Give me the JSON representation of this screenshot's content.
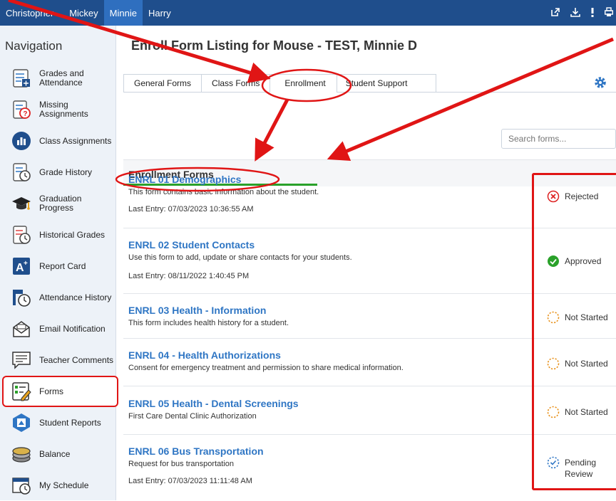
{
  "topbar": {
    "tabs": [
      {
        "label": "Christopher"
      },
      {
        "label": "Mickey"
      },
      {
        "label": "Minnie"
      },
      {
        "label": "Harry"
      }
    ],
    "active_tab": "Minnie"
  },
  "sidebar": {
    "title": "Navigation",
    "items": [
      {
        "label": "Grades and Attendance",
        "icon": "grades-attendance-icon"
      },
      {
        "label": "Missing Assignments",
        "icon": "missing-assignments-icon"
      },
      {
        "label": "Class Assignments",
        "icon": "class-assignments-icon"
      },
      {
        "label": "Grade History",
        "icon": "grade-history-icon"
      },
      {
        "label": "Graduation Progress",
        "icon": "graduation-cap-icon"
      },
      {
        "label": "Historical Grades",
        "icon": "historical-grades-icon"
      },
      {
        "label": "Report Card",
        "icon": "report-card-icon"
      },
      {
        "label": "Attendance History",
        "icon": "attendance-history-icon"
      },
      {
        "label": "Email Notification",
        "icon": "email-icon"
      },
      {
        "label": "Teacher Comments",
        "icon": "comments-icon"
      },
      {
        "label": "Forms",
        "icon": "forms-icon"
      },
      {
        "label": "Student Reports",
        "icon": "student-reports-icon"
      },
      {
        "label": "Balance",
        "icon": "balance-icon"
      },
      {
        "label": "My Schedule",
        "icon": "schedule-icon"
      }
    ]
  },
  "main": {
    "title": "Enroll Form Listing for Mouse - TEST, Minnie D",
    "tabs": [
      {
        "label": "General Forms"
      },
      {
        "label": "Class Forms"
      },
      {
        "label": "Enrollment"
      },
      {
        "label": "Student Support"
      }
    ],
    "active_tab": "Enrollment",
    "search_placeholder": "Search forms...",
    "section_title": "Enrollment Forms",
    "forms": [
      {
        "title": "ENRL 01 Demographics",
        "desc": "This form contains basic information about the student.",
        "entry": "Last Entry: 07/03/2023 10:36:55 AM",
        "status": "Rejected"
      },
      {
        "title": "ENRL 02 Student Contacts",
        "desc": "Use this form to add, update or share contacts for your students.",
        "entry": "Last Entry: 08/11/2022 1:40:45 PM",
        "status": "Approved"
      },
      {
        "title": "ENRL 03 Health - Information",
        "desc": "This form includes health history for a student.",
        "entry": "",
        "status": "Not Started"
      },
      {
        "title": "ENRL 04 - Health Authorizations",
        "desc": "Consent for emergency treatment and permission to share medical information.",
        "entry": "",
        "status": "Not Started"
      },
      {
        "title": "ENRL 05 Health - Dental Screenings",
        "desc": "First Care Dental Clinic Authorization",
        "entry": "",
        "status": "Not Started"
      },
      {
        "title": "ENRL 06 Bus Transportation",
        "desc": "Request for bus transportation",
        "entry": "Last Entry: 07/03/2023 11:11:48 AM",
        "status_line1": "Pending",
        "status_line2": "Review"
      }
    ]
  },
  "colors": {
    "topbar": "#1f4e8c",
    "active_topbar_tab": "#2f6fbf",
    "link": "#2f76c4",
    "annotation_red": "#e01515",
    "accent_green": "#2aa12a"
  }
}
